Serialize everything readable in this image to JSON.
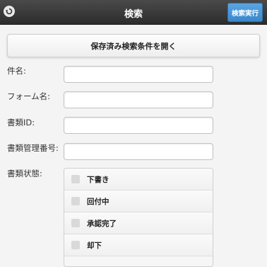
{
  "header": {
    "title": "検索",
    "execute_label": "検索実行",
    "back_icon": "back-arrow-icon"
  },
  "open_saved_label": "保存済み検索条件を開く",
  "fields": {
    "subject_label": "件名:",
    "subject_value": "",
    "form_name_label": "フォーム名:",
    "form_name_value": "",
    "doc_id_label": "書類ID:",
    "doc_id_value": "",
    "doc_mgmt_label": "書類管理番号:",
    "doc_mgmt_value": ""
  },
  "status": {
    "label": "書類状態:",
    "options": [
      "下書き",
      "回付中",
      "承認完了",
      "却下"
    ]
  }
}
